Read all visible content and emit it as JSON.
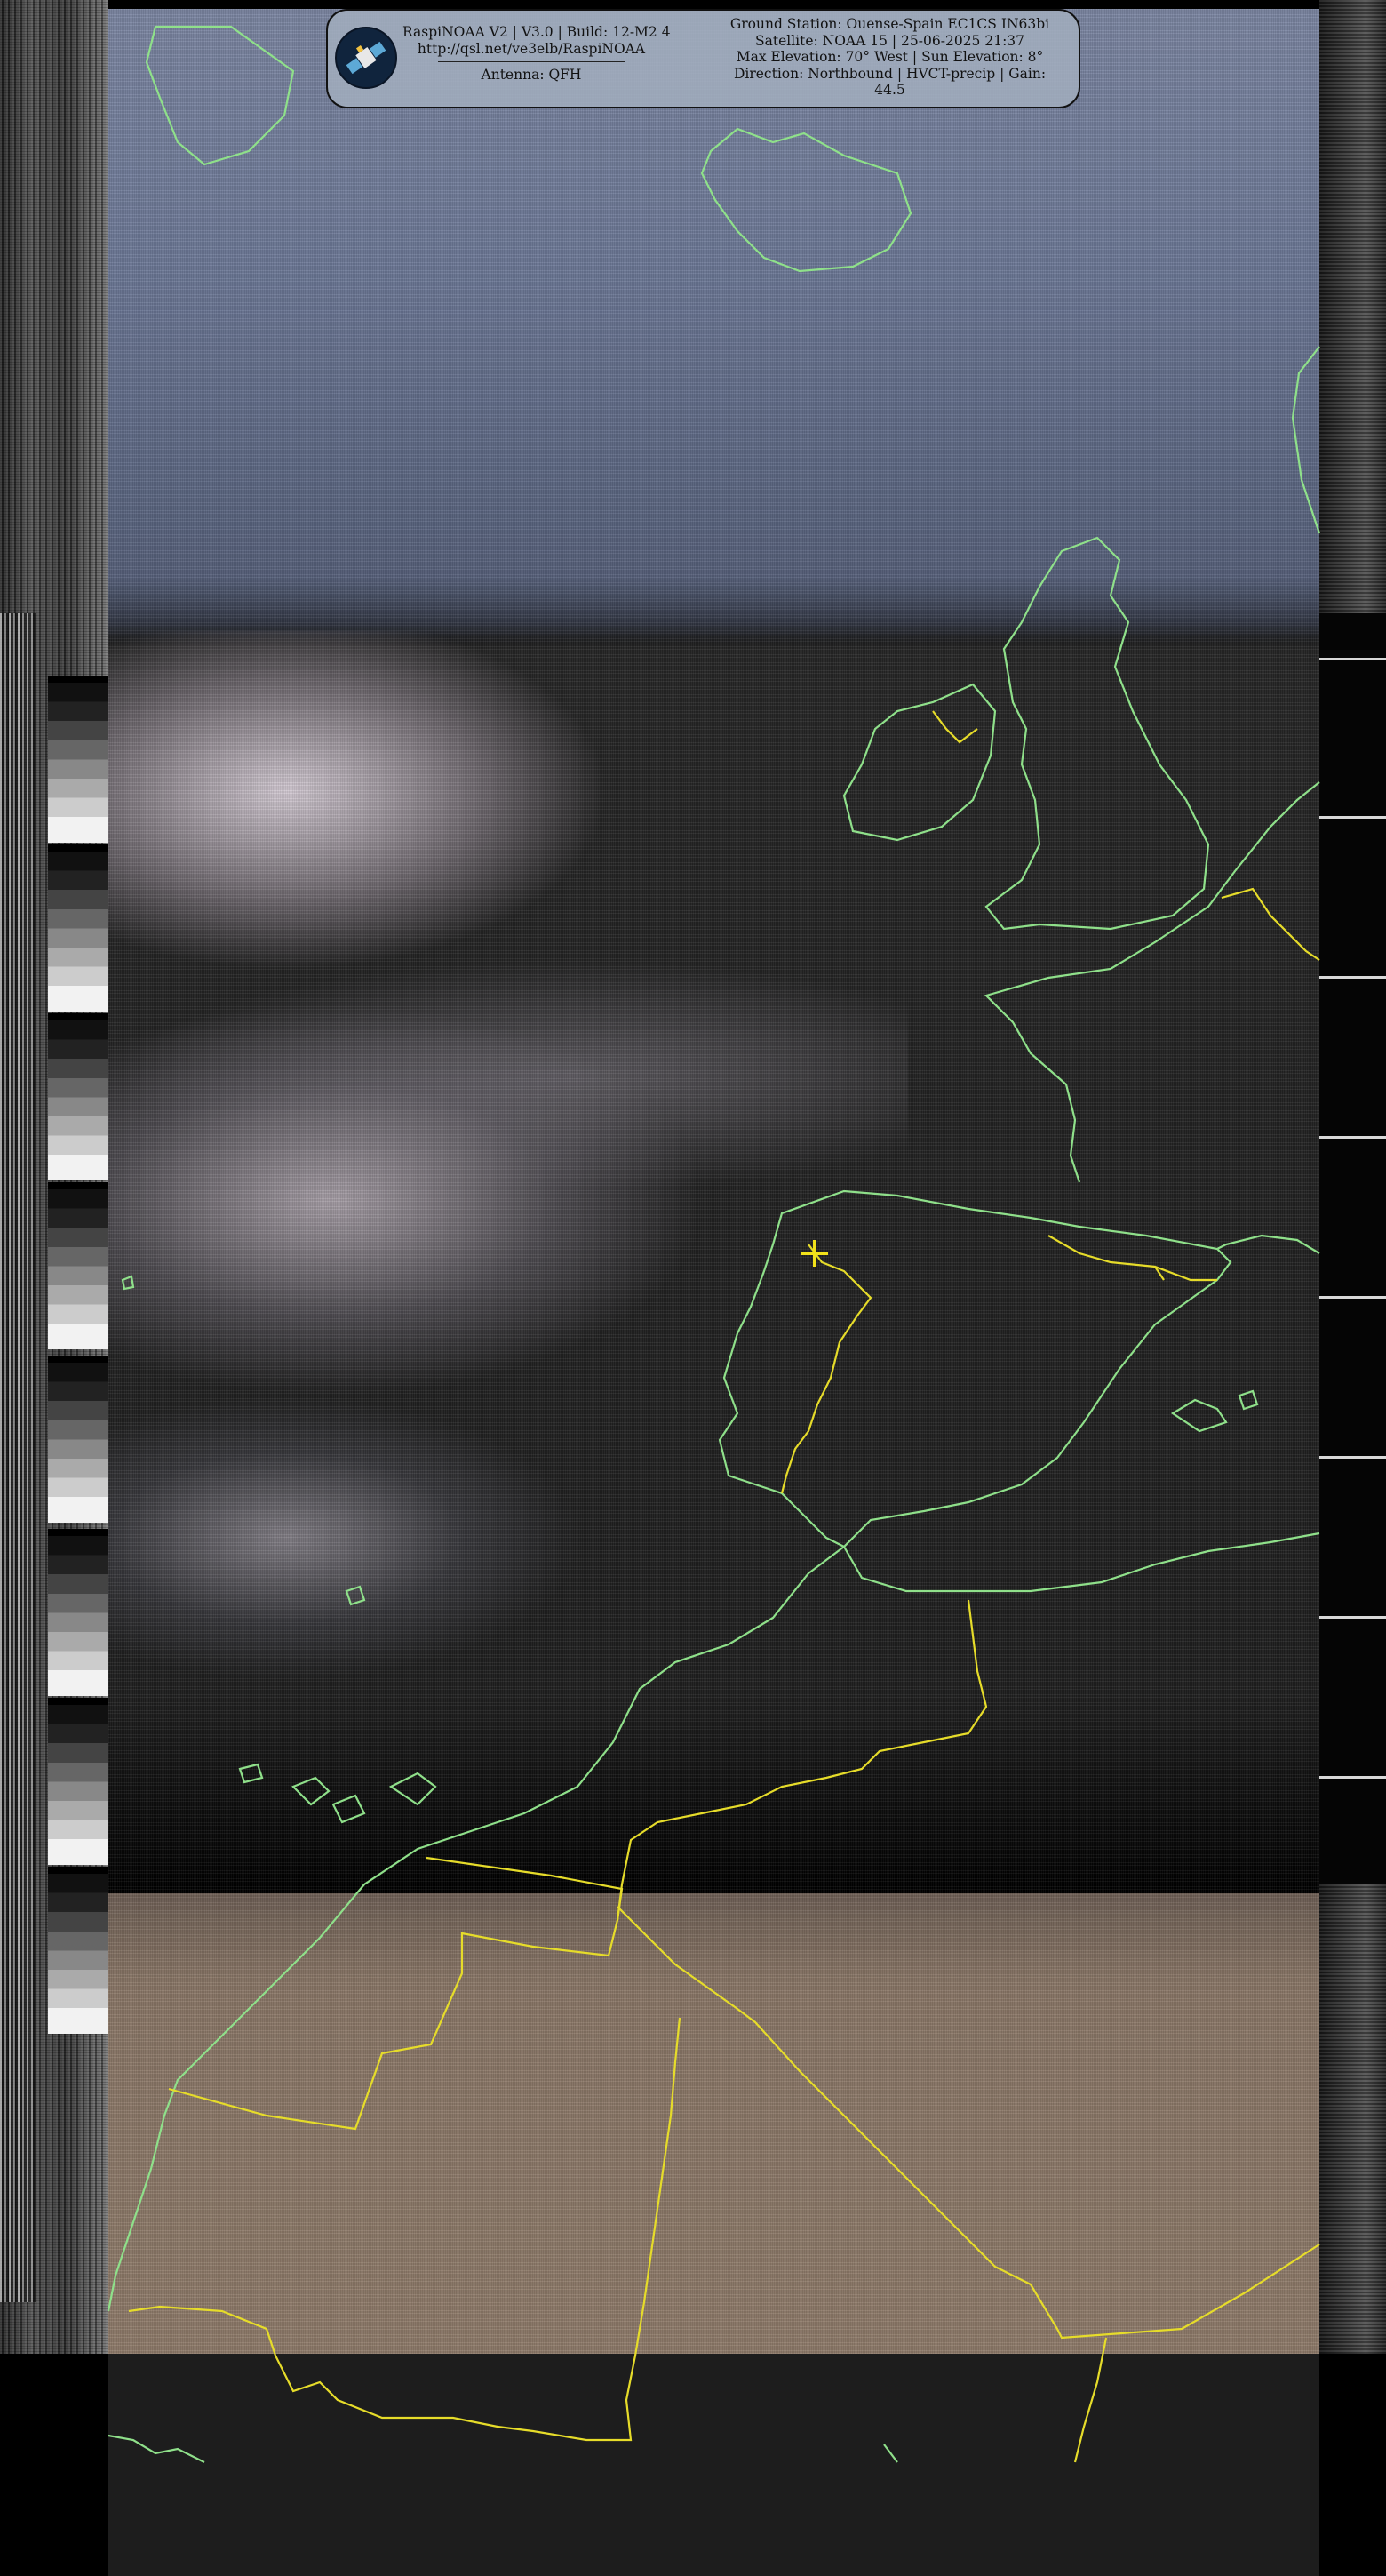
{
  "header": {
    "software": "RaspiNOAA V2 | V3.0 | Build: 12-M2 4",
    "url": "http://qsl.net/ve3elb/RaspiNOAA",
    "antenna": "Antenna: QFH",
    "ground_station": "Ground Station: Ouense-Spain EC1CS  IN63bi",
    "satellite": "Satellite: NOAA 15 | 25-06-2025 21:37",
    "elevation": "Max Elevation: 70° West | Sun Elevation: 8°",
    "direction": "Direction: Northbound | HVCT-precip | Gain:",
    "gain": "44.5"
  },
  "icons": {
    "logo": "satellite-icon",
    "station_marker": "crosshair-icon"
  },
  "colors": {
    "coastline": "#8fe08a",
    "border": "#e6dc2a",
    "marker": "#f2e21a",
    "panel": "#a2aebe"
  }
}
